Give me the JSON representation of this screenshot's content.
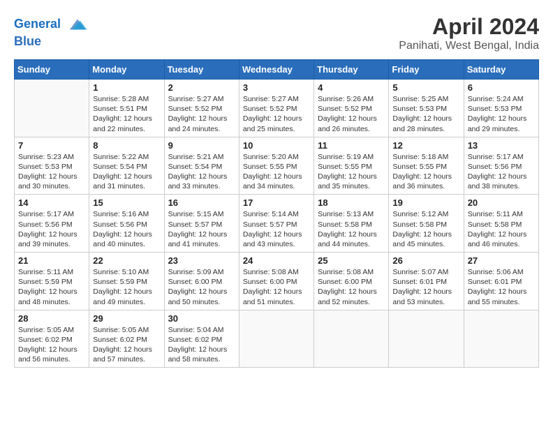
{
  "header": {
    "logo_line1": "General",
    "logo_line2": "Blue",
    "month_title": "April 2024",
    "location": "Panihati, West Bengal, India"
  },
  "weekdays": [
    "Sunday",
    "Monday",
    "Tuesday",
    "Wednesday",
    "Thursday",
    "Friday",
    "Saturday"
  ],
  "weeks": [
    [
      {
        "day": "",
        "info": ""
      },
      {
        "day": "1",
        "info": "Sunrise: 5:28 AM\nSunset: 5:51 PM\nDaylight: 12 hours\nand 22 minutes."
      },
      {
        "day": "2",
        "info": "Sunrise: 5:27 AM\nSunset: 5:52 PM\nDaylight: 12 hours\nand 24 minutes."
      },
      {
        "day": "3",
        "info": "Sunrise: 5:27 AM\nSunset: 5:52 PM\nDaylight: 12 hours\nand 25 minutes."
      },
      {
        "day": "4",
        "info": "Sunrise: 5:26 AM\nSunset: 5:52 PM\nDaylight: 12 hours\nand 26 minutes."
      },
      {
        "day": "5",
        "info": "Sunrise: 5:25 AM\nSunset: 5:53 PM\nDaylight: 12 hours\nand 28 minutes."
      },
      {
        "day": "6",
        "info": "Sunrise: 5:24 AM\nSunset: 5:53 PM\nDaylight: 12 hours\nand 29 minutes."
      }
    ],
    [
      {
        "day": "7",
        "info": "Sunrise: 5:23 AM\nSunset: 5:53 PM\nDaylight: 12 hours\nand 30 minutes."
      },
      {
        "day": "8",
        "info": "Sunrise: 5:22 AM\nSunset: 5:54 PM\nDaylight: 12 hours\nand 31 minutes."
      },
      {
        "day": "9",
        "info": "Sunrise: 5:21 AM\nSunset: 5:54 PM\nDaylight: 12 hours\nand 33 minutes."
      },
      {
        "day": "10",
        "info": "Sunrise: 5:20 AM\nSunset: 5:55 PM\nDaylight: 12 hours\nand 34 minutes."
      },
      {
        "day": "11",
        "info": "Sunrise: 5:19 AM\nSunset: 5:55 PM\nDaylight: 12 hours\nand 35 minutes."
      },
      {
        "day": "12",
        "info": "Sunrise: 5:18 AM\nSunset: 5:55 PM\nDaylight: 12 hours\nand 36 minutes."
      },
      {
        "day": "13",
        "info": "Sunrise: 5:17 AM\nSunset: 5:56 PM\nDaylight: 12 hours\nand 38 minutes."
      }
    ],
    [
      {
        "day": "14",
        "info": "Sunrise: 5:17 AM\nSunset: 5:56 PM\nDaylight: 12 hours\nand 39 minutes."
      },
      {
        "day": "15",
        "info": "Sunrise: 5:16 AM\nSunset: 5:56 PM\nDaylight: 12 hours\nand 40 minutes."
      },
      {
        "day": "16",
        "info": "Sunrise: 5:15 AM\nSunset: 5:57 PM\nDaylight: 12 hours\nand 41 minutes."
      },
      {
        "day": "17",
        "info": "Sunrise: 5:14 AM\nSunset: 5:57 PM\nDaylight: 12 hours\nand 43 minutes."
      },
      {
        "day": "18",
        "info": "Sunrise: 5:13 AM\nSunset: 5:58 PM\nDaylight: 12 hours\nand 44 minutes."
      },
      {
        "day": "19",
        "info": "Sunrise: 5:12 AM\nSunset: 5:58 PM\nDaylight: 12 hours\nand 45 minutes."
      },
      {
        "day": "20",
        "info": "Sunrise: 5:11 AM\nSunset: 5:58 PM\nDaylight: 12 hours\nand 46 minutes."
      }
    ],
    [
      {
        "day": "21",
        "info": "Sunrise: 5:11 AM\nSunset: 5:59 PM\nDaylight: 12 hours\nand 48 minutes."
      },
      {
        "day": "22",
        "info": "Sunrise: 5:10 AM\nSunset: 5:59 PM\nDaylight: 12 hours\nand 49 minutes."
      },
      {
        "day": "23",
        "info": "Sunrise: 5:09 AM\nSunset: 6:00 PM\nDaylight: 12 hours\nand 50 minutes."
      },
      {
        "day": "24",
        "info": "Sunrise: 5:08 AM\nSunset: 6:00 PM\nDaylight: 12 hours\nand 51 minutes."
      },
      {
        "day": "25",
        "info": "Sunrise: 5:08 AM\nSunset: 6:00 PM\nDaylight: 12 hours\nand 52 minutes."
      },
      {
        "day": "26",
        "info": "Sunrise: 5:07 AM\nSunset: 6:01 PM\nDaylight: 12 hours\nand 53 minutes."
      },
      {
        "day": "27",
        "info": "Sunrise: 5:06 AM\nSunset: 6:01 PM\nDaylight: 12 hours\nand 55 minutes."
      }
    ],
    [
      {
        "day": "28",
        "info": "Sunrise: 5:05 AM\nSunset: 6:02 PM\nDaylight: 12 hours\nand 56 minutes."
      },
      {
        "day": "29",
        "info": "Sunrise: 5:05 AM\nSunset: 6:02 PM\nDaylight: 12 hours\nand 57 minutes."
      },
      {
        "day": "30",
        "info": "Sunrise: 5:04 AM\nSunset: 6:02 PM\nDaylight: 12 hours\nand 58 minutes."
      },
      {
        "day": "",
        "info": ""
      },
      {
        "day": "",
        "info": ""
      },
      {
        "day": "",
        "info": ""
      },
      {
        "day": "",
        "info": ""
      }
    ]
  ]
}
